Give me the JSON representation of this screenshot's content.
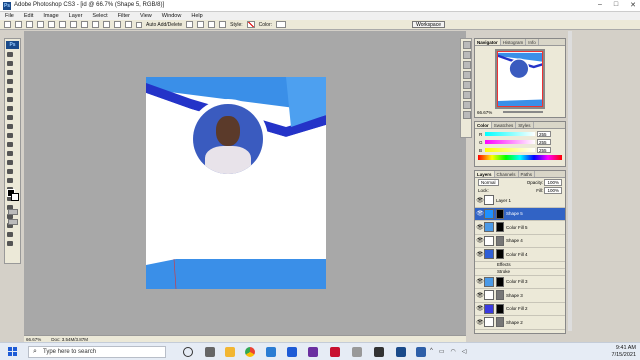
{
  "window": {
    "title": "Adobe Photoshop CS3 - [id @ 66.7% (Shape 5, RGB/8)]"
  },
  "menu": [
    "File",
    "Edit",
    "Image",
    "Layer",
    "Select",
    "Filter",
    "View",
    "Window",
    "Help"
  ],
  "options": {
    "auto_add_delete": "Auto Add/Delete",
    "style_label": "Style:",
    "color_label": "Color:",
    "workspace": "Workspace"
  },
  "status": {
    "zoom": "66.67%",
    "doc": "Doc: 3.54M/3.87M"
  },
  "navigator": {
    "tabs": [
      "Navigator",
      "Histogram",
      "Info"
    ],
    "zoom": "66.67%"
  },
  "color_panel": {
    "tabs": [
      "Color",
      "Swatches",
      "Styles"
    ],
    "channels": [
      {
        "label": "R",
        "value": "255"
      },
      {
        "label": "G",
        "value": "255"
      },
      {
        "label": "B",
        "value": "255"
      }
    ]
  },
  "layers_panel": {
    "tabs": [
      "Layers",
      "Channels",
      "Paths"
    ],
    "blend": "Normal",
    "opacity_label": "Opacity:",
    "opacity": "100%",
    "lock_label": "Lock:",
    "fill_label": "Fill:",
    "fill": "100%",
    "layers": [
      {
        "name": "Layer 1",
        "thumb": "#ffffff",
        "selected": false
      },
      {
        "name": "Shape 5",
        "thumb": "#1e90ff",
        "selected": true
      },
      {
        "name": "Color Fill 5",
        "thumb": "#4a9ae8",
        "selected": false
      },
      {
        "name": "Shape 4",
        "thumb": "#ffffff",
        "selected": false
      },
      {
        "name": "Color Fill 4",
        "thumb": "#2f5fd8",
        "selected": false
      }
    ],
    "effects_label": "Effects",
    "stroke_label": "Stroke",
    "layers_bottom": [
      {
        "name": "Color Fill 3",
        "thumb": "#4a9ae8"
      },
      {
        "name": "Shape 3",
        "thumb": "#ffffff"
      },
      {
        "name": "Color Fill 2",
        "thumb": "#3a3ae0"
      },
      {
        "name": "Shape 2",
        "thumb": "#ffffff"
      }
    ]
  },
  "taskbar": {
    "search_placeholder": "Type here to search",
    "time": "9:41 AM",
    "date": "7/15/2021"
  },
  "colors": {
    "accent_blue": "#3a8fe8",
    "dark_blue": "#2433c8",
    "canvas_bg": "#a8a8a8"
  }
}
